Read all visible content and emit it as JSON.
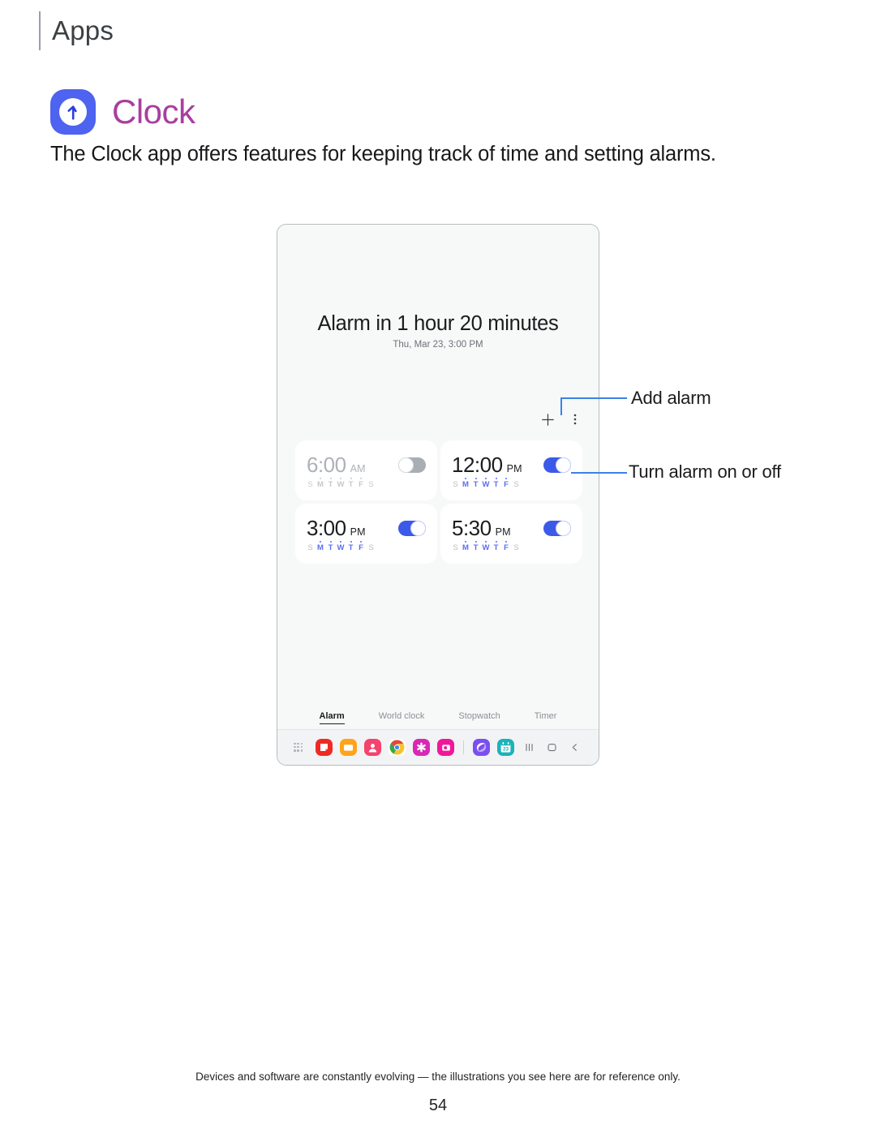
{
  "page": {
    "section_header": "Apps",
    "app_name": "Clock",
    "app_icon": "clock-icon",
    "description": "The Clock app offers features for keeping track of time and setting alarms.",
    "footer_note": "Devices and software are constantly evolving — the illustrations you see here are for reference only.",
    "page_number": "54",
    "accent_color": "#a83fa0",
    "callout_color": "#3b82e6"
  },
  "callouts": [
    {
      "label": "Add alarm",
      "target": "add-alarm-button"
    },
    {
      "label": "Turn alarm on or off",
      "target": "alarm-toggle"
    }
  ],
  "device": {
    "headline": "Alarm in 1 hour 20 minutes",
    "subline": "Thu, Mar 23, 3:00 PM",
    "toolbar": {
      "add_label": "+",
      "more_label": "⋮"
    },
    "alarms": [
      {
        "time": "6:00",
        "meridiem": "AM",
        "enabled": false,
        "days": [
          {
            "letter": "S",
            "on": false
          },
          {
            "letter": "M",
            "on": true
          },
          {
            "letter": "T",
            "on": true
          },
          {
            "letter": "W",
            "on": true
          },
          {
            "letter": "T",
            "on": true
          },
          {
            "letter": "F",
            "on": true
          },
          {
            "letter": "S",
            "on": false
          }
        ]
      },
      {
        "time": "12:00",
        "meridiem": "PM",
        "enabled": true,
        "days": [
          {
            "letter": "S",
            "on": false
          },
          {
            "letter": "M",
            "on": true
          },
          {
            "letter": "T",
            "on": true
          },
          {
            "letter": "W",
            "on": true
          },
          {
            "letter": "T",
            "on": true
          },
          {
            "letter": "F",
            "on": true
          },
          {
            "letter": "S",
            "on": false
          }
        ]
      },
      {
        "time": "3:00",
        "meridiem": "PM",
        "enabled": true,
        "days": [
          {
            "letter": "S",
            "on": false
          },
          {
            "letter": "M",
            "on": true
          },
          {
            "letter": "T",
            "on": true
          },
          {
            "letter": "W",
            "on": true
          },
          {
            "letter": "T",
            "on": true
          },
          {
            "letter": "F",
            "on": true
          },
          {
            "letter": "S",
            "on": false
          }
        ]
      },
      {
        "time": "5:30",
        "meridiem": "PM",
        "enabled": true,
        "days": [
          {
            "letter": "S",
            "on": false
          },
          {
            "letter": "M",
            "on": true
          },
          {
            "letter": "T",
            "on": true
          },
          {
            "letter": "W",
            "on": true
          },
          {
            "letter": "T",
            "on": true
          },
          {
            "letter": "F",
            "on": true
          },
          {
            "letter": "S",
            "on": false
          }
        ]
      }
    ],
    "tabs": [
      {
        "label": "Alarm",
        "active": true
      },
      {
        "label": "World clock",
        "active": false
      },
      {
        "label": "Stopwatch",
        "active": false
      },
      {
        "label": "Timer",
        "active": false
      }
    ],
    "taskbar": {
      "apps_grid_icon": "apps-grid-icon",
      "apps": [
        {
          "name": "samsung-notes-icon",
          "color": "#ef2a23"
        },
        {
          "name": "my-files-icon",
          "color": "#ffa41b"
        },
        {
          "name": "contacts-icon",
          "color": "#f4436c"
        },
        {
          "name": "chrome-icon",
          "color": "#ffffff"
        },
        {
          "name": "galaxy-store-icon",
          "color": "#d928b4"
        },
        {
          "name": "instagram-icon",
          "color": "#f01898"
        },
        {
          "name": "samsung-internet-icon",
          "color": "#7b4ff0"
        },
        {
          "name": "calendar-icon",
          "color": "#1ab3ba",
          "badge": "23"
        }
      ],
      "nav": [
        {
          "name": "recents-button",
          "glyph": "|||"
        },
        {
          "name": "home-button",
          "glyph": "⬜"
        },
        {
          "name": "back-button",
          "glyph": "‹"
        }
      ]
    }
  }
}
